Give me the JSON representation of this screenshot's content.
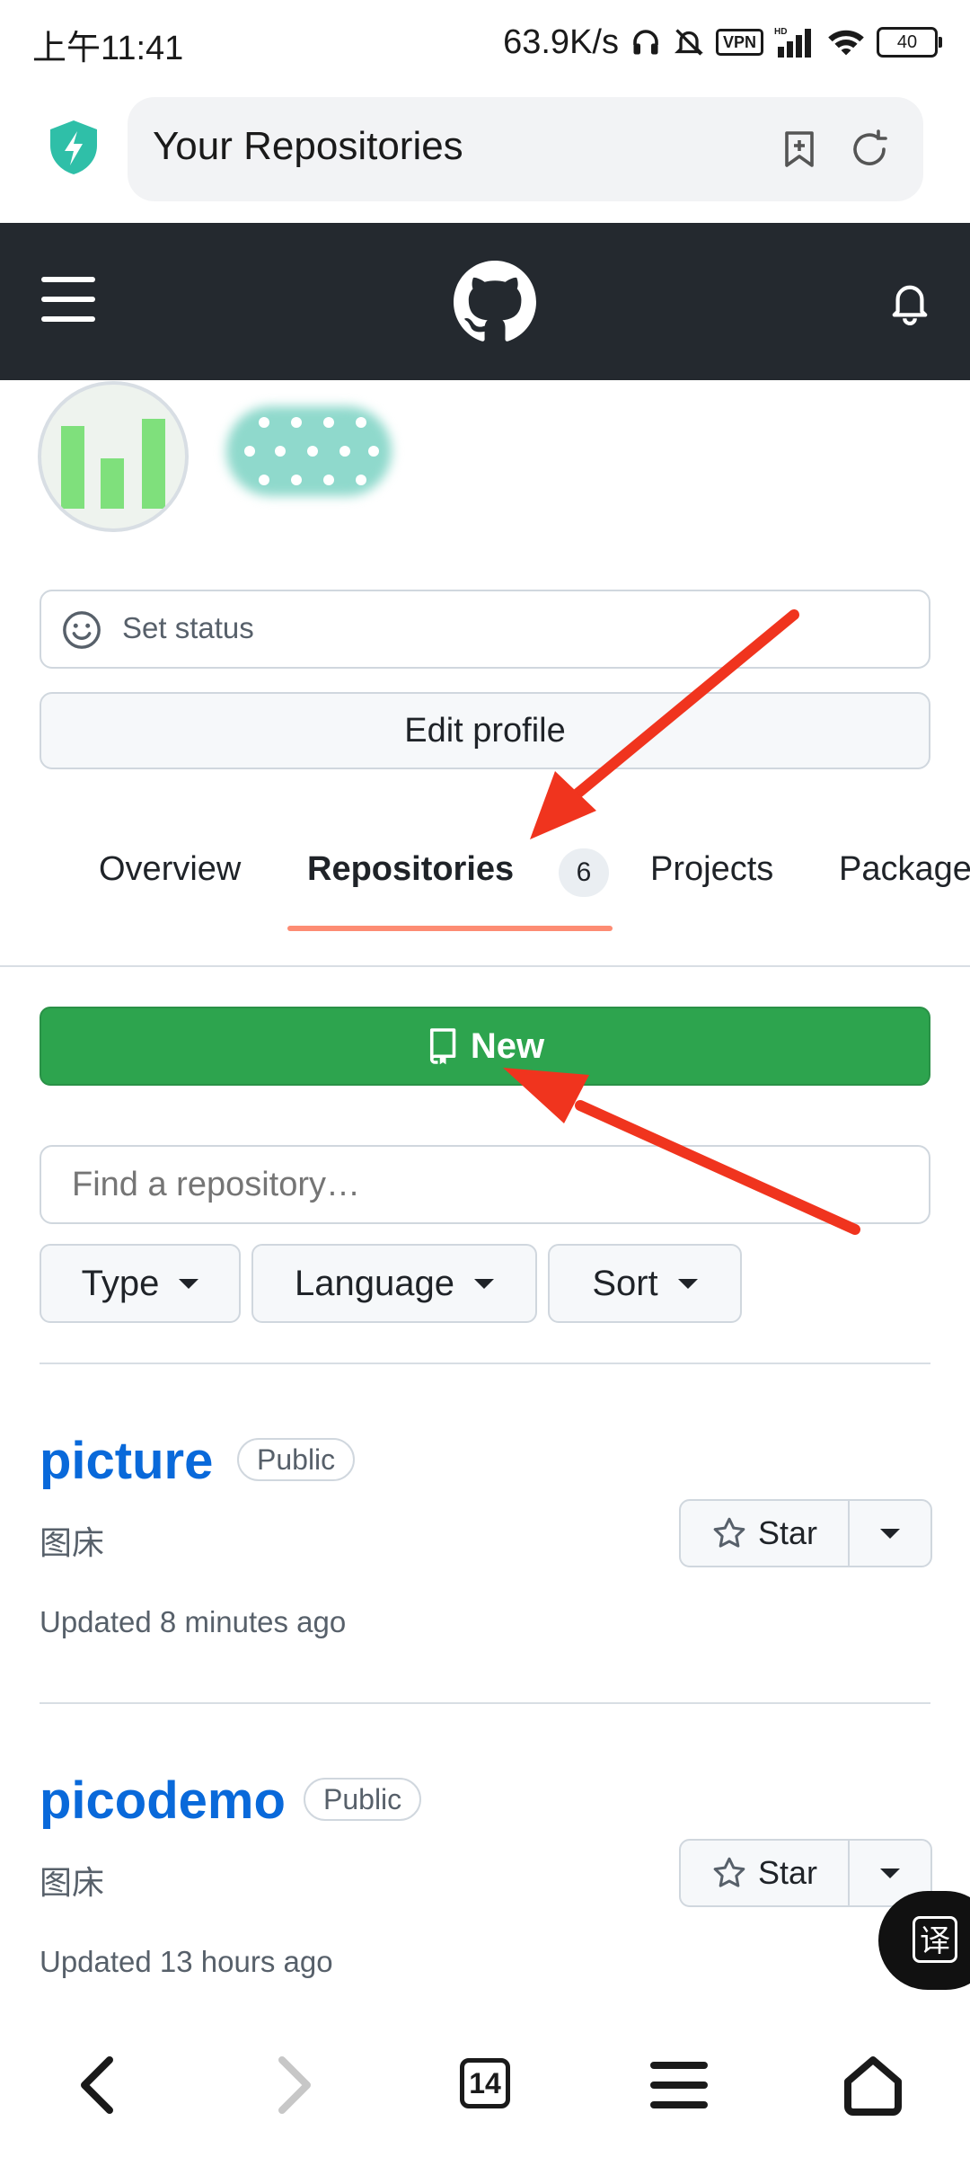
{
  "status_bar": {
    "time": "上午11:41",
    "network_speed": "63.9K/s",
    "vpn_label": "VPN",
    "hd_label": "HD",
    "battery": "40"
  },
  "browser": {
    "url_title": "Your Repositories",
    "shield_color": "#2fbfa8"
  },
  "profile": {
    "set_status_label": "Set status",
    "edit_profile_label": "Edit profile"
  },
  "tabs": [
    {
      "label": "Overview"
    },
    {
      "label": "Repositories",
      "count": "6"
    },
    {
      "label": "Projects"
    },
    {
      "label": "Package"
    }
  ],
  "actions": {
    "new_label": "New",
    "find_placeholder": "Find a repository…",
    "filters": [
      {
        "label": "Type"
      },
      {
        "label": "Language"
      },
      {
        "label": "Sort"
      }
    ]
  },
  "repositories": [
    {
      "name": "picture",
      "visibility": "Public",
      "description": "图床",
      "updated": "Updated 8 minutes ago",
      "star_label": "Star"
    },
    {
      "name": "picodemo",
      "visibility": "Public",
      "description": "图床",
      "updated": "Updated 13 hours ago",
      "star_label": "Star"
    }
  ],
  "overlay": {
    "translate_label": "译"
  },
  "bottom_nav": {
    "tabs_count": "14"
  },
  "colors": {
    "github_header": "#24292f",
    "new_button": "#2da44e",
    "link": "#0969da",
    "tab_underline": "#fd8c73",
    "annotation_arrow": "#f0341e"
  }
}
